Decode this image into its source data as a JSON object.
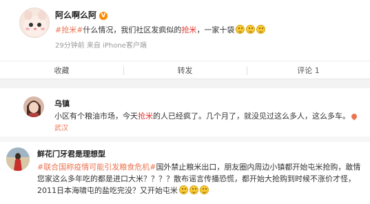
{
  "post1": {
    "username": "阿么啊么阿",
    "badge": "V",
    "topic1": "#抢米#",
    "text_a": "什么情况，我们社区发疯似的",
    "hl": "抢米",
    "text_b": "，一家十袋",
    "meta": "29分钟前  来自 iPhone客户端"
  },
  "actions": {
    "collect": "收藏",
    "repost": "转发",
    "comment": "评论 1"
  },
  "post2": {
    "username": "乌镇",
    "text_a": "小区有个粮油市场，今天",
    "hl": "抢米",
    "text_b": "的人已经疯了。几个月了，就没见过这么多人，这么多车。",
    "location": "武汉"
  },
  "post3": {
    "username": "鲜花门牙君是理想型",
    "topic1": "#联合国称疫情可能引发粮食危机#",
    "text_a": "国外禁止粮米出口，朋友圈内周边小镇都开始屯米抢购，敢情您家这么多年吃的都是进口大米？？？？散布谣言传播恐慌，都开始大抢购到时候不涨价才怪，2011日本海啸屯的盐吃完没？又开始屯米"
  },
  "colors": {
    "topic": "#eb7350",
    "highlight": "#e6322e",
    "meta": "#999999"
  },
  "icons": [
    "emoji-smile-icon",
    "location-pin-icon",
    "vip-badge-icon"
  ]
}
